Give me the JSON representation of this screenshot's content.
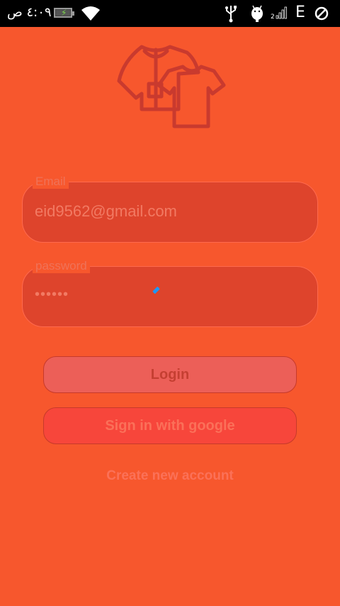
{
  "status_bar": {
    "time": "٤:٠٩ ص",
    "network_type": "E",
    "sim_slot": "2"
  },
  "app": {
    "logo_icon": "clothes-icon"
  },
  "form": {
    "email_label": "Email",
    "email_value": "eid9562@gmail.com",
    "password_label": "password",
    "password_value": "••••••"
  },
  "buttons": {
    "login_label": "Login",
    "google_label": "Sign in with google",
    "create_account_label": "Create new account"
  },
  "colors": {
    "background": "#f7572d",
    "field_fill": "#de442c",
    "login_button": "#ec5f58",
    "google_button": "#f7463b"
  }
}
